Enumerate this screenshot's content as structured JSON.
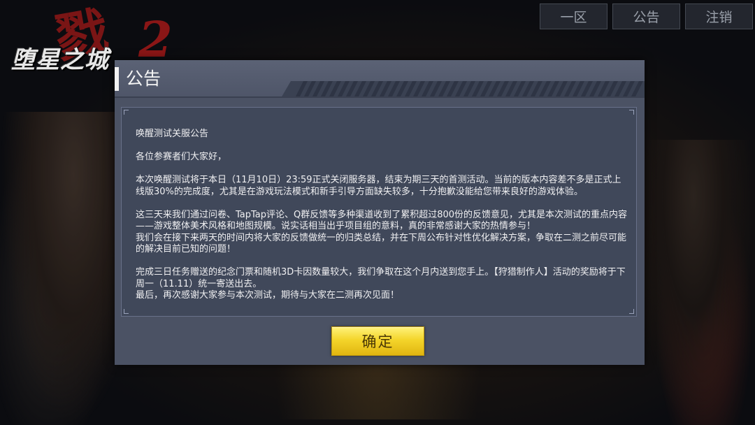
{
  "logo": {
    "mark": "戮",
    "name": "堕星之城",
    "number": "2"
  },
  "top_buttons": [
    {
      "label": "一区"
    },
    {
      "label": "公告"
    },
    {
      "label": "注销"
    }
  ],
  "dialog": {
    "title": "公告",
    "paragraphs": [
      "唤醒测试关服公告",
      "各位参赛者们大家好，",
      "本次唤醒测试将于本日（11月10日）23:59正式关闭服务器，结束为期三天的首测活动。当前的版本内容差不多是正式上线版30%的完成度，尤其是在游戏玩法模式和新手引导方面缺失较多，十分抱歉没能给您带来良好的游戏体验。",
      "这三天来我们通过问卷、TapTap评论、Q群反馈等多种渠道收到了累积超过800份的反馈意见，尤其是本次测试的重点内容——游戏整体美术风格和地图规模。说实话相当出乎项目组的意料，真的非常感谢大家的热情参与！\n我们会在接下来两天的时间内将大家的反馈做统一的归类总结，并在下周公布针对性优化解决方案，争取在二测之前尽可能的解决目前已知的问题！",
      "完成三日任务赠送的纪念门票和随机3D卡因数量较大，我们争取在这个月内送到您手上。【狩猎制作人】活动的奖励将于下周一（11.11）统一寄送出去。\n最后，再次感谢大家参与本次测试，期待与大家在二测再次见面！"
    ],
    "confirm_label": "确定"
  },
  "colors": {
    "dialog_bg": "#4b5264",
    "content_bg": "#40485a",
    "confirm_button": "#f4d52b",
    "logo_red": "#8a1616"
  }
}
